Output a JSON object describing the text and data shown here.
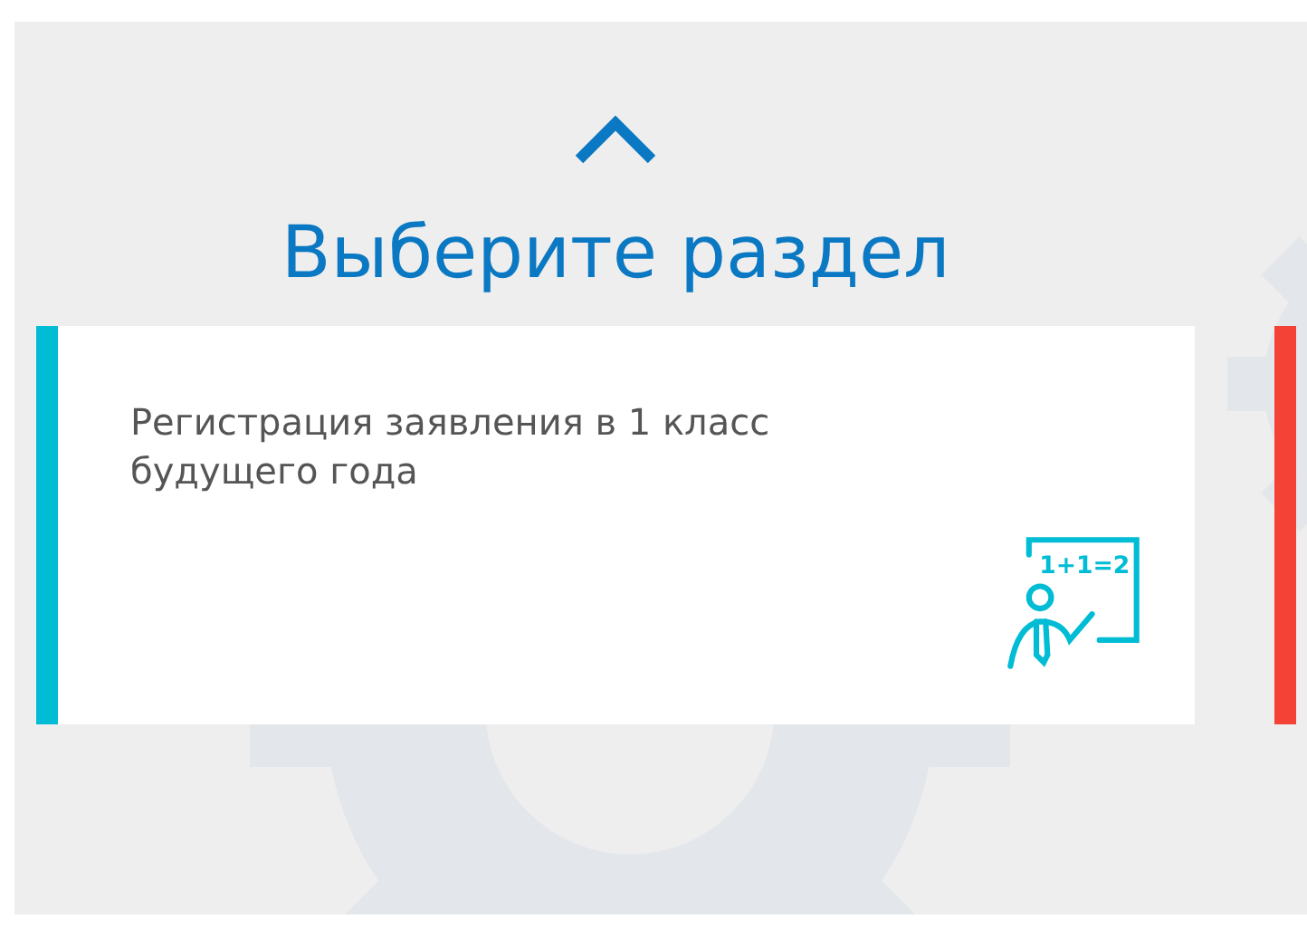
{
  "heading": "Выберите раздел",
  "cards": [
    {
      "title": "Регистрация заявления в 1 класс будущего года",
      "color": "#00bcd4",
      "board_text": "1+1=2"
    },
    {
      "color": "#f44336"
    }
  ]
}
